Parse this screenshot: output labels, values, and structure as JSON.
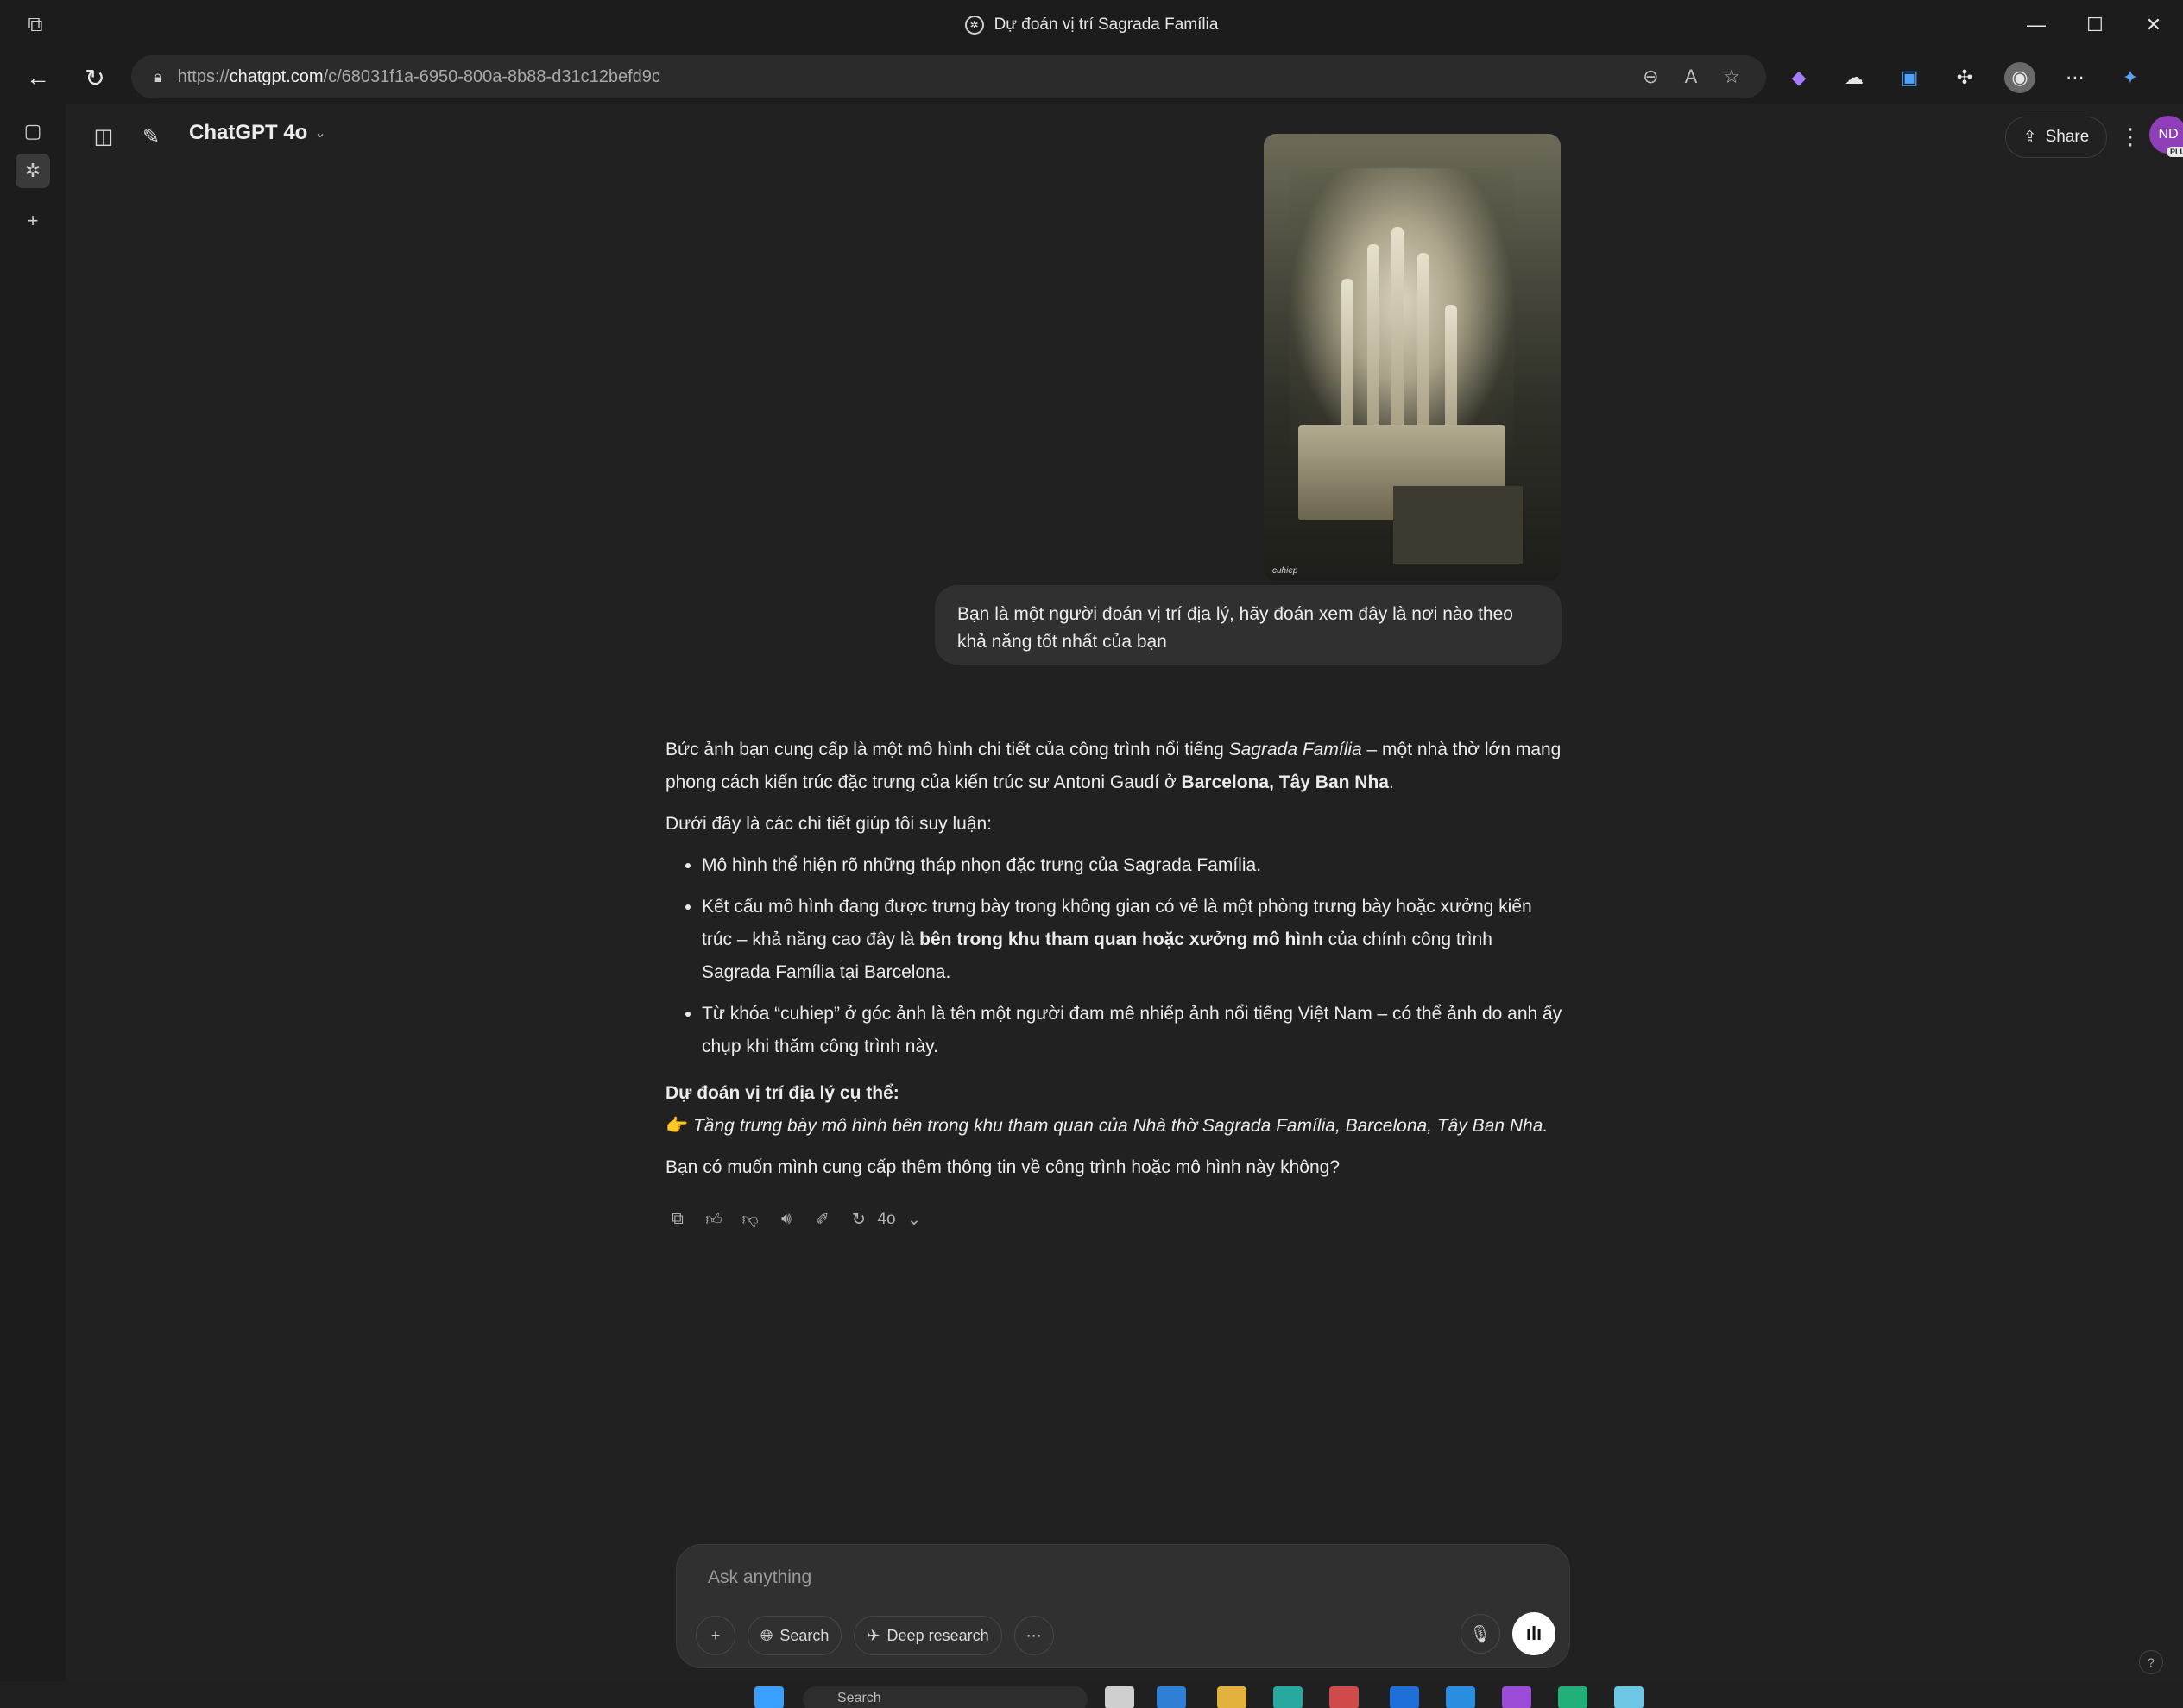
{
  "window": {
    "title": "Dự đoán vị trí Sagrada Família",
    "minimize": "—",
    "maximize": "☐",
    "close": "✕"
  },
  "browser": {
    "url_prefix": "https://",
    "url_host": "chatgpt.com",
    "url_path": "/c/68031f1a-6950-800a-8b88-d31c12befd9c"
  },
  "header": {
    "model_name": "ChatGPT 4o",
    "share_label": "Share",
    "avatar_initials": "ND",
    "avatar_badge": "PLUS"
  },
  "conversation": {
    "image_watermark": "cuhiep",
    "user_message": "Bạn là một người đoán vị trí địa lý, hãy đoán xem đây là nơi nào theo khả năng tốt nhất của bạn",
    "answer": {
      "p1_a": "Bức ảnh bạn cung cấp là một mô hình chi tiết của công trình nổi tiếng ",
      "p1_italic": "Sagrada Família",
      "p1_b": " – một nhà thờ lớn mang phong cách kiến trúc đặc trưng của kiến trúc sư Antoni Gaudí ở ",
      "p1_bold": "Barcelona, Tây Ban Nha",
      "p1_c": ".",
      "p2": "Dưới đây là các chi tiết giúp tôi suy luận:",
      "bullet1": "Mô hình thể hiện rõ những tháp nhọn đặc trưng của Sagrada Família.",
      "bullet2_a": "Kết cấu mô hình đang được trưng bày trong không gian có vẻ là một phòng trưng bày hoặc xưởng kiến trúc – khả năng cao đây là ",
      "bullet2_bold": "bên trong khu tham quan hoặc xưởng mô hình",
      "bullet2_b": " của chính công trình Sagrada Família tại Barcelona.",
      "bullet3": "Từ khóa “cuhiep” ở góc ảnh là tên một người đam mê nhiếp ảnh nổi tiếng Việt Nam – có thể ảnh do anh ấy chụp khi thăm công trình này.",
      "prediction_heading": "Dự đoán vị trí địa lý cụ thể:",
      "prediction_emoji": "👉",
      "prediction_text": "Tầng trưng bày mô hình bên trong khu tham quan của Nhà thờ Sagrada Família, Barcelona, Tây Ban Nha.",
      "closing": "Bạn có muốn mình cung cấp thêm thông tin về công trình hoặc mô hình này không?"
    },
    "action_model": "4o"
  },
  "composer": {
    "placeholder": "Ask anything",
    "search_label": "Search",
    "deep_research_label": "Deep research"
  },
  "taskbar": {
    "search_placeholder": "Search"
  },
  "help_label": "?"
}
